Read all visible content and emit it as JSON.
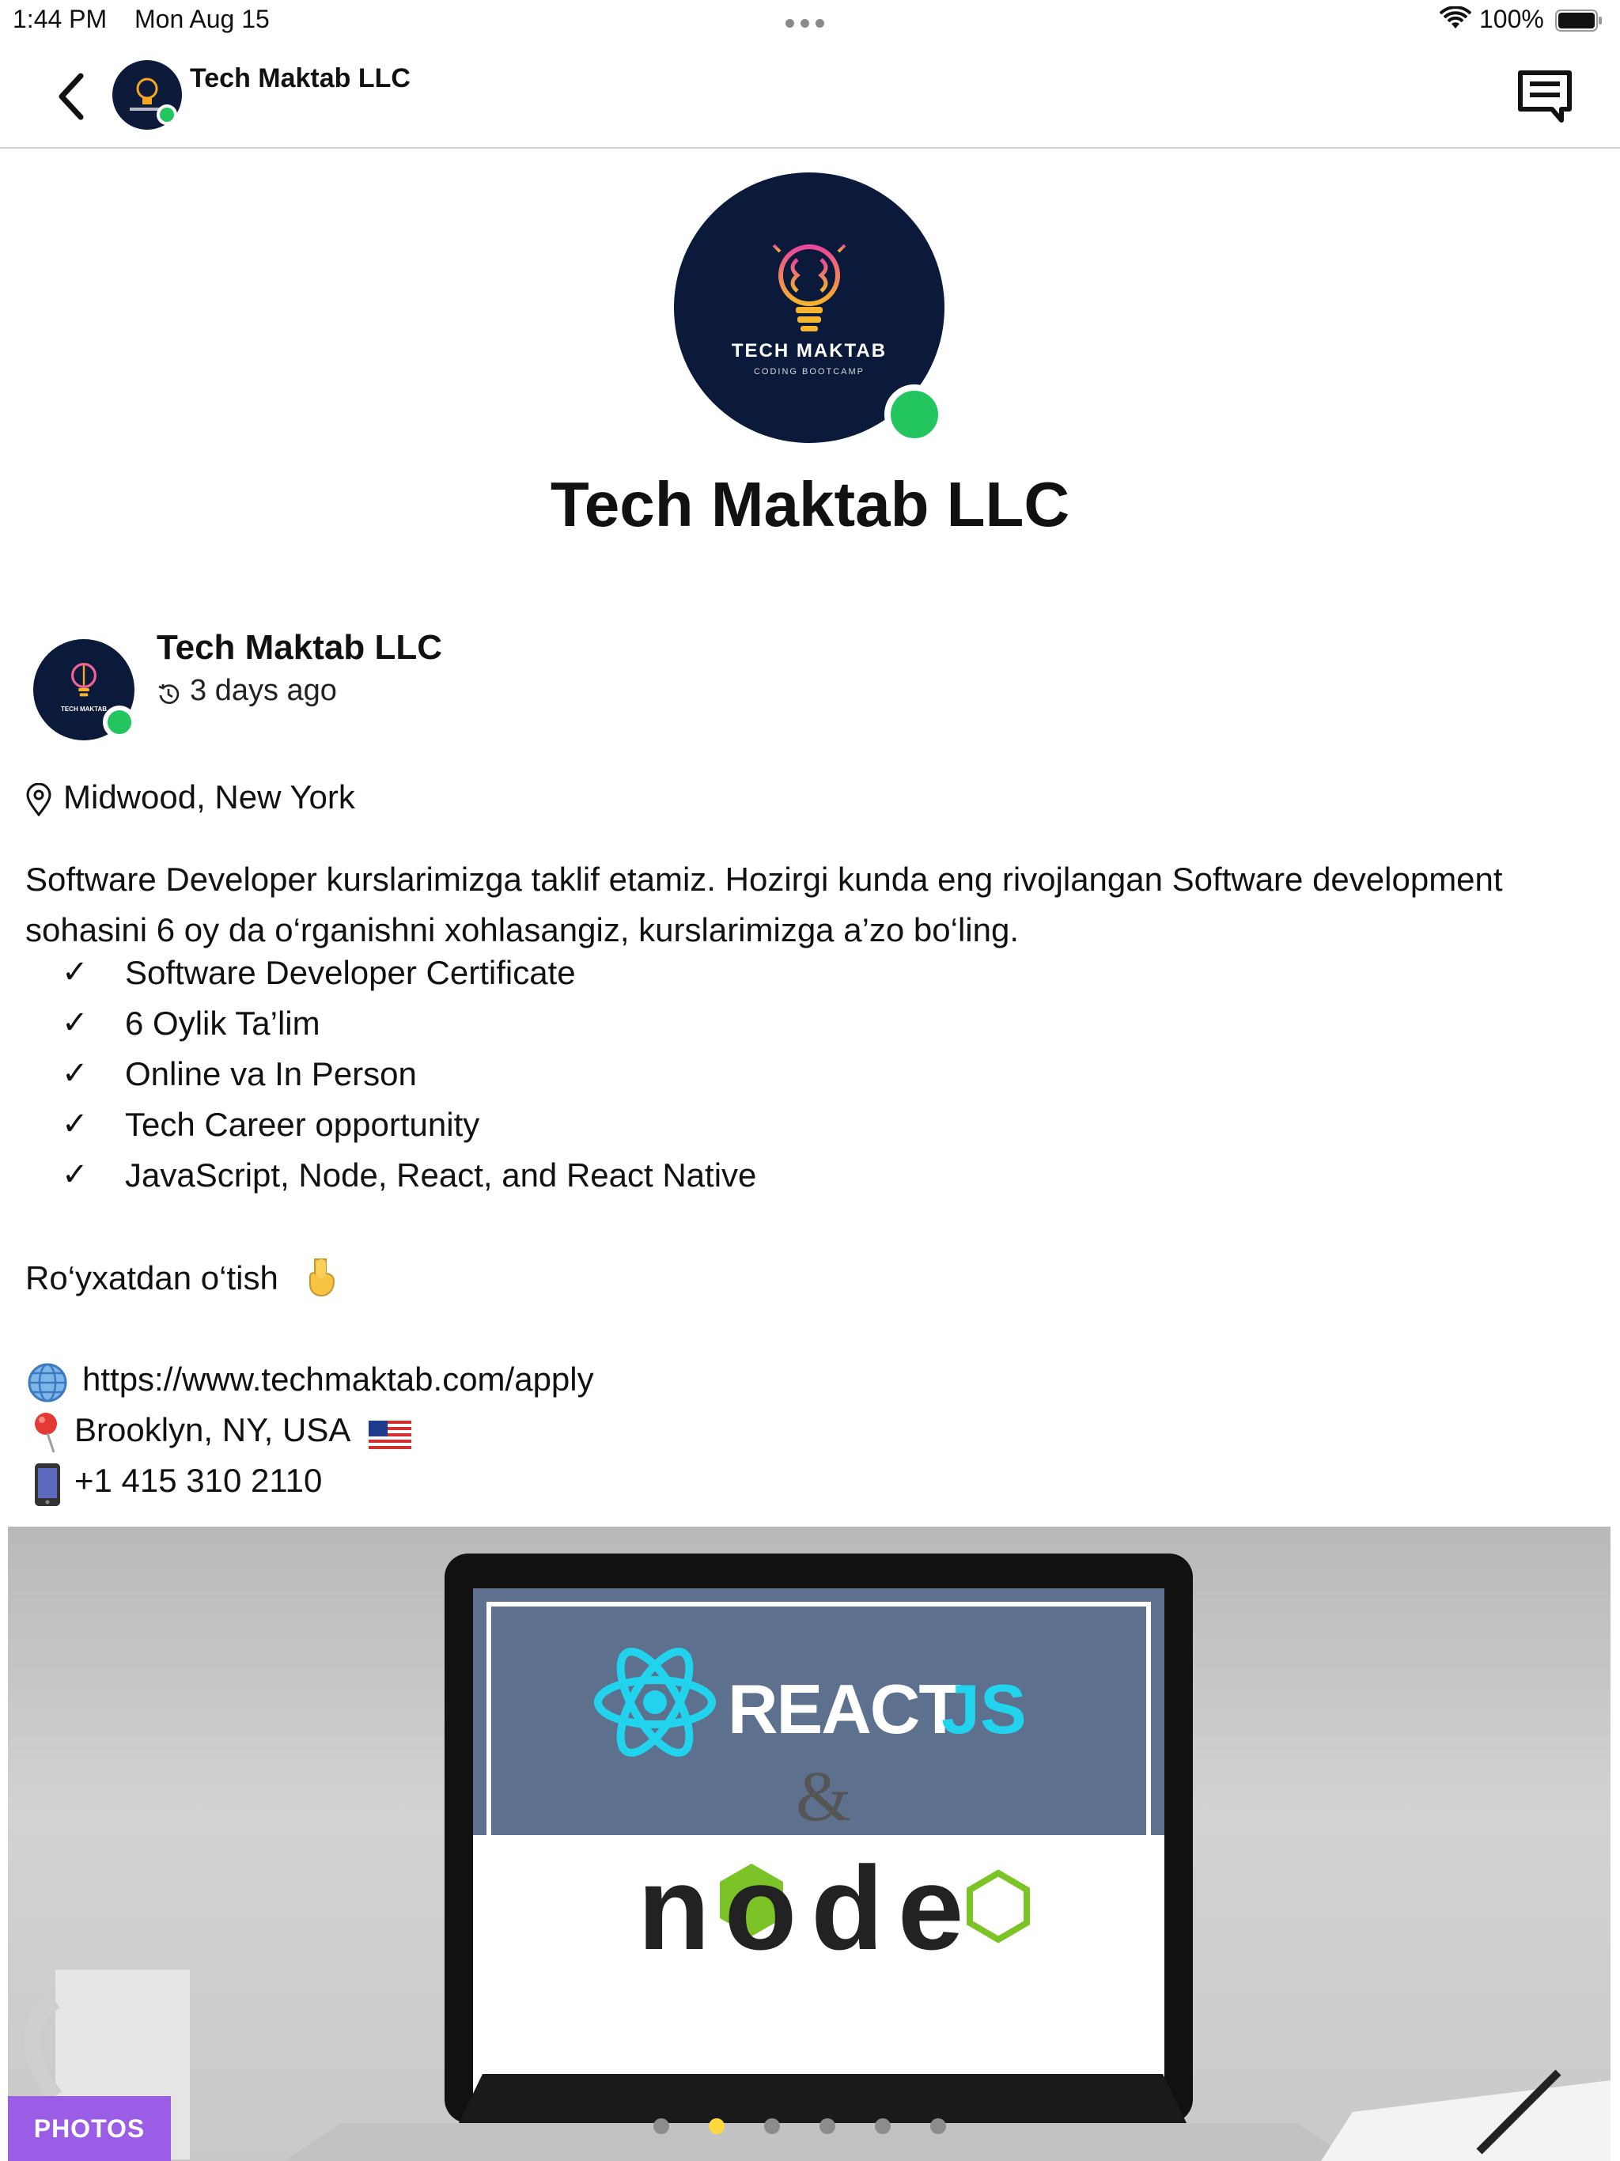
{
  "status_bar": {
    "time": "1:44 PM",
    "date": "Mon Aug 15",
    "battery": "100%"
  },
  "nav": {
    "title": "Tech Maktab LLC",
    "back_icon": "chevron-left-icon",
    "chat_icon": "chat-icon"
  },
  "profile": {
    "name": "Tech Maktab LLC",
    "logo_line1": "TECH MAKTAB",
    "logo_line2": "CODING BOOTCAMP",
    "online": true
  },
  "post": {
    "author": "Tech Maktab LLC",
    "time_ago": "3 days ago",
    "location": "Midwood, New York",
    "body_line1": "Software Developer kurslarimizga taklif etamiz. Hozirgi kunda eng rivojlangan Software development",
    "body_line2": "sohasini 6 oy da o‘rganishni xohlasangiz, kurslarimizga a’zo bo‘ling.",
    "checks": [
      "Software Developer Certificate",
      "6 Oylik Ta’lim",
      "Online va In Person",
      "Tech Career opportunity",
      "JavaScript, Node, React, and React Native"
    ],
    "cta": "Ro‘yxatdan o‘tish",
    "website": "https://www.techmaktab.com/apply",
    "address": "Brooklyn, NY, USA",
    "phone": "+1 415 310 2110"
  },
  "photo": {
    "badge": "PHOTOS",
    "react_text": "REACT",
    "js_text": "JS",
    "amp": "&",
    "node_text": "node",
    "dot_count": 6,
    "active_dot": 1
  },
  "colors": {
    "online": "#22c55e",
    "badge": "#9b5de5",
    "active_dot": "#ffd93b",
    "logo_bg": "#0b1a3b"
  }
}
